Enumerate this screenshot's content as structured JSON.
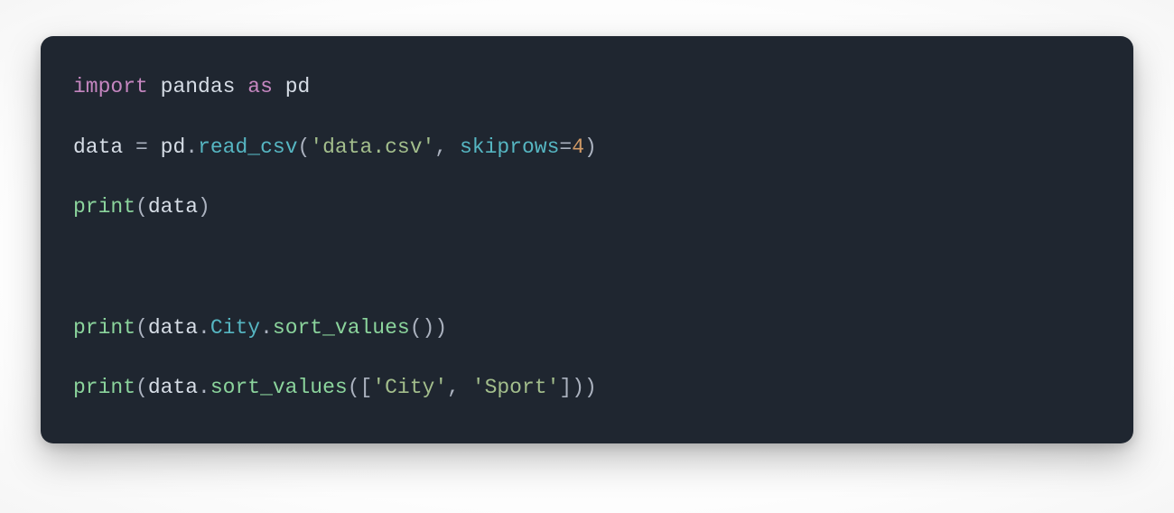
{
  "code": {
    "l1": {
      "import": "import",
      "module": "pandas",
      "as": "as",
      "alias": "pd"
    },
    "l2": {
      "lhs": "data",
      "eq": "=",
      "obj": "pd",
      "dot1": ".",
      "method": "read_csv",
      "lpar": "(",
      "arg1": "'data.csv'",
      "comma": ",",
      "kw": "skiprows",
      "assign": "=",
      "val": "4",
      "rpar": ")"
    },
    "l3": {
      "fn": "print",
      "lpar": "(",
      "arg": "data",
      "rpar": ")"
    },
    "l4": {
      "fn": "print",
      "lpar": "(",
      "obj": "data",
      "dot1": ".",
      "attr": "City",
      "dot2": ".",
      "method": "sort_values",
      "lpar2": "(",
      "rpar2": ")",
      "rpar": ")"
    },
    "l5": {
      "fn": "print",
      "lpar": "(",
      "obj": "data",
      "dot1": ".",
      "method": "sort_values",
      "lpar2": "(",
      "lbr": "[",
      "s1": "'City'",
      "comma": ",",
      "s2": "'Sport'",
      "rbr": "]",
      "rpar2": ")",
      "rpar": ")"
    }
  }
}
